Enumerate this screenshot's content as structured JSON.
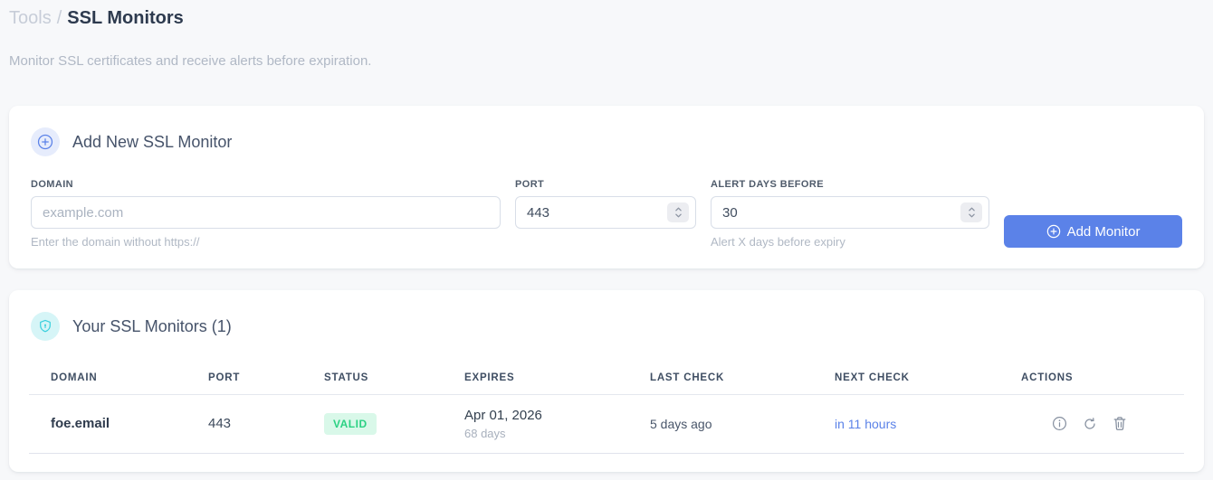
{
  "page": {
    "breadcrumb": {
      "section": "Tools",
      "separator": "/",
      "current": "SSL Monitors"
    },
    "subtitle": "Monitor SSL certificates and receive alerts before expiration."
  },
  "add_form": {
    "title": "Add New SSL Monitor",
    "icon": "plus-circle-icon",
    "fields": {
      "domain": {
        "label": "DOMAIN",
        "placeholder": "example.com",
        "value": "",
        "helper": "Enter the domain without https://"
      },
      "port": {
        "label": "PORT",
        "value": "443"
      },
      "alert_days": {
        "label": "ALERT DAYS BEFORE",
        "value": "30",
        "helper": "Alert X days before expiry"
      }
    },
    "submit_label": "Add Monitor"
  },
  "monitors": {
    "title": "Your SSL Monitors (1)",
    "count": 1,
    "icon": "shield-icon",
    "table": {
      "headers": [
        "DOMAIN",
        "PORT",
        "STATUS",
        "EXPIRES",
        "LAST CHECK",
        "NEXT CHECK",
        "ACTIONS"
      ],
      "rows": [
        {
          "domain": "foe.email",
          "port": "443",
          "status": "VALID",
          "expires_date": "Apr 01, 2026",
          "expires_days": "68 days",
          "last_check": "5 days ago",
          "next_check": "in 11 hours",
          "actions": [
            "info-icon",
            "refresh-icon",
            "trash-icon"
          ]
        }
      ]
    }
  },
  "colors": {
    "accent_blue": "#5b82e8",
    "status_valid_bg": "#d9f8e9",
    "status_valid_text": "#2bd183",
    "icon_teal": "#38d0dd",
    "page_background": "#f7f8fa"
  }
}
